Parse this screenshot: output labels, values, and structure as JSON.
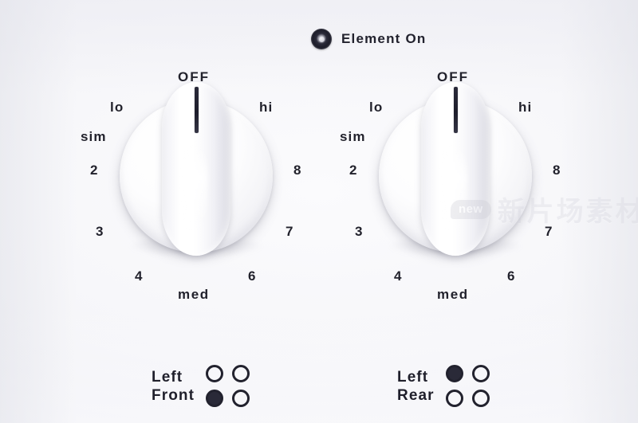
{
  "panel": {
    "device": "Electric range cooktop control panel",
    "surface_color": "#f4f4f8"
  },
  "indicator": {
    "icon": "element-on-lamp-icon",
    "label": "Element On",
    "state": "off",
    "lamp_color": "#1c1c29"
  },
  "knobs": [
    {
      "id": "left",
      "position": "Left Front",
      "setting": "OFF",
      "pointer_angle_deg": 0,
      "labels": {
        "off": "OFF",
        "lo": "lo",
        "sim": "sim",
        "n2": "2",
        "n3": "3",
        "n4": "4",
        "med": "med",
        "n6": "6",
        "n7": "7",
        "n8": "8",
        "hi": "hi"
      }
    },
    {
      "id": "right",
      "position": "Left Rear",
      "setting": "OFF",
      "pointer_angle_deg": 0,
      "labels": {
        "off": "OFF",
        "lo": "lo",
        "sim": "sim",
        "n2": "2",
        "n3": "3",
        "n4": "4",
        "med": "med",
        "n6": "6",
        "n7": "7",
        "n8": "8",
        "hi": "hi"
      }
    }
  ],
  "burner_indicators": [
    {
      "id": "left",
      "line1": "Left",
      "line2": "Front",
      "dots": [
        "off",
        "off",
        "on",
        "off"
      ]
    },
    {
      "id": "right",
      "line1": "Left",
      "line2": "Rear",
      "dots": [
        "on",
        "off",
        "off",
        "off"
      ]
    }
  ],
  "watermark": {
    "badge": "new",
    "text": "新片场素材"
  }
}
